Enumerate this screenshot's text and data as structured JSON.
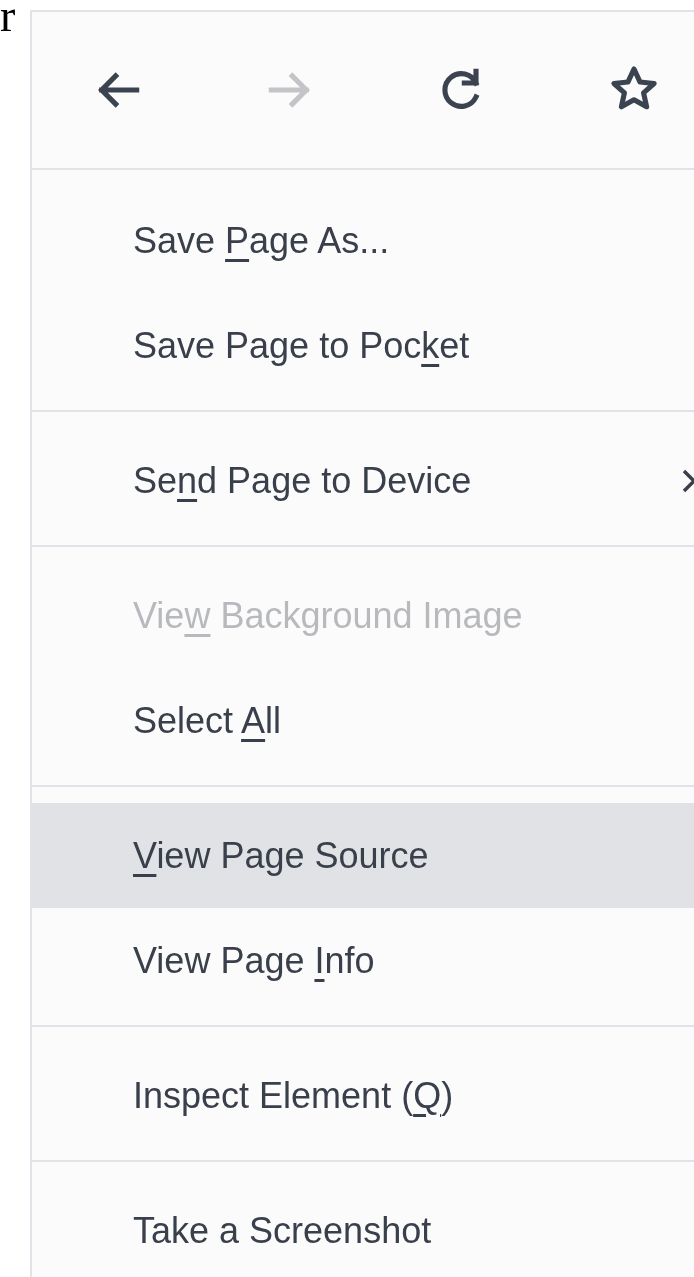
{
  "page_fragment": "r",
  "nav": [
    {
      "kind": "back",
      "disabled": false
    },
    {
      "kind": "forward",
      "disabled": true
    },
    {
      "kind": "reload",
      "disabled": false
    },
    {
      "kind": "bookmark",
      "disabled": false
    }
  ],
  "menu": [
    {
      "kind": "item",
      "before": "Save ",
      "key": "P",
      "after": "age As...",
      "disabled": false,
      "selected": false,
      "submenu": false
    },
    {
      "kind": "item",
      "before": "Save Page to Poc",
      "key": "k",
      "after": "et",
      "disabled": false,
      "selected": false,
      "submenu": false
    },
    {
      "kind": "separator"
    },
    {
      "kind": "item",
      "before": "Se",
      "key": "n",
      "after": "d Page to Device",
      "disabled": false,
      "selected": false,
      "submenu": true
    },
    {
      "kind": "separator"
    },
    {
      "kind": "item",
      "before": "Vie",
      "key": "w",
      "after": " Background Image",
      "disabled": true,
      "selected": false,
      "submenu": false
    },
    {
      "kind": "item",
      "before": "Select ",
      "key": "A",
      "after": "ll",
      "disabled": false,
      "selected": false,
      "submenu": false
    },
    {
      "kind": "separator"
    },
    {
      "kind": "item",
      "key": "V",
      "after": "iew Page Source",
      "disabled": false,
      "selected": true,
      "submenu": false
    },
    {
      "kind": "item",
      "before": "View Page ",
      "key": "I",
      "after": "nfo",
      "disabled": false,
      "selected": false,
      "submenu": false
    },
    {
      "kind": "separator"
    },
    {
      "kind": "item",
      "before": "Inspect Element (",
      "key": "Q",
      "after": ")",
      "disabled": false,
      "selected": false,
      "submenu": false
    },
    {
      "kind": "separator"
    },
    {
      "kind": "item",
      "before": "Take a Screenshot",
      "disabled": false,
      "selected": false,
      "submenu": false
    }
  ]
}
